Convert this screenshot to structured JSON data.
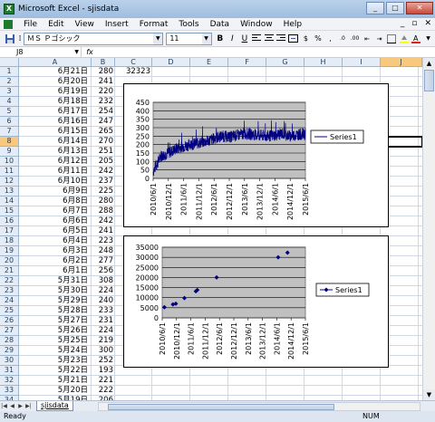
{
  "window": {
    "title": "Microsoft Excel - sjisdata",
    "min": "_",
    "max": "□",
    "close": "✕"
  },
  "menu": [
    "File",
    "Edit",
    "View",
    "Insert",
    "Format",
    "Tools",
    "Data",
    "Window",
    "Help"
  ],
  "menu_doc_controls": [
    "_",
    "▫",
    "✕"
  ],
  "toolbar": {
    "font_name": "ＭＳ Ｐゴシック",
    "font_size": "11",
    "bold": "B",
    "italic": "I",
    "underline": "U"
  },
  "formula_bar": {
    "name_box": "J8",
    "fx": "fx",
    "value": ""
  },
  "columns": [
    "A",
    "B",
    "C",
    "D",
    "E",
    "F",
    "G",
    "H",
    "I",
    "J"
  ],
  "active_column": "J",
  "active_row": 8,
  "rows": [
    {
      "n": "1",
      "a": "6月21日",
      "b": "280",
      "c": "32323"
    },
    {
      "n": "2",
      "a": "6月20日",
      "b": "241",
      "c": ""
    },
    {
      "n": "3",
      "a": "6月19日",
      "b": "220",
      "c": ""
    },
    {
      "n": "4",
      "a": "6月18日",
      "b": "232",
      "c": ""
    },
    {
      "n": "5",
      "a": "6月17日",
      "b": "254",
      "c": ""
    },
    {
      "n": "6",
      "a": "6月16日",
      "b": "247",
      "c": ""
    },
    {
      "n": "7",
      "a": "6月15日",
      "b": "265",
      "c": ""
    },
    {
      "n": "8",
      "a": "6月14日",
      "b": "270",
      "c": ""
    },
    {
      "n": "9",
      "a": "6月13日",
      "b": "251",
      "c": ""
    },
    {
      "n": "10",
      "a": "6月12日",
      "b": "205",
      "c": ""
    },
    {
      "n": "11",
      "a": "6月11日",
      "b": "242",
      "c": ""
    },
    {
      "n": "12",
      "a": "6月10日",
      "b": "237",
      "c": ""
    },
    {
      "n": "13",
      "a": "6月9日",
      "b": "225",
      "c": ""
    },
    {
      "n": "14",
      "a": "6月8日",
      "b": "280",
      "c": ""
    },
    {
      "n": "15",
      "a": "6月7日",
      "b": "288",
      "c": ""
    },
    {
      "n": "16",
      "a": "6月6日",
      "b": "242",
      "c": ""
    },
    {
      "n": "17",
      "a": "6月5日",
      "b": "241",
      "c": ""
    },
    {
      "n": "18",
      "a": "6月4日",
      "b": "223",
      "c": ""
    },
    {
      "n": "19",
      "a": "6月3日",
      "b": "248",
      "c": ""
    },
    {
      "n": "20",
      "a": "6月2日",
      "b": "277",
      "c": ""
    },
    {
      "n": "21",
      "a": "6月1日",
      "b": "256",
      "c": ""
    },
    {
      "n": "22",
      "a": "5月31日",
      "b": "308",
      "c": ""
    },
    {
      "n": "23",
      "a": "5月30日",
      "b": "224",
      "c": ""
    },
    {
      "n": "24",
      "a": "5月29日",
      "b": "240",
      "c": ""
    },
    {
      "n": "25",
      "a": "5月28日",
      "b": "233",
      "c": ""
    },
    {
      "n": "26",
      "a": "5月27日",
      "b": "231",
      "c": ""
    },
    {
      "n": "27",
      "a": "5月26日",
      "b": "224",
      "c": ""
    },
    {
      "n": "28",
      "a": "5月25日",
      "b": "219",
      "c": ""
    },
    {
      "n": "29",
      "a": "5月24日",
      "b": "300",
      "c": ""
    },
    {
      "n": "30",
      "a": "5月23日",
      "b": "252",
      "c": ""
    },
    {
      "n": "31",
      "a": "5月22日",
      "b": "193",
      "c": ""
    },
    {
      "n": "32",
      "a": "5月21日",
      "b": "221",
      "c": ""
    },
    {
      "n": "33",
      "a": "5月20日",
      "b": "222",
      "c": ""
    },
    {
      "n": "34",
      "a": "5月19日",
      "b": "206",
      "c": ""
    }
  ],
  "sheet_tab": "sjisdata",
  "status": {
    "left": "Ready",
    "num": "NUM"
  },
  "chart_data": [
    {
      "type": "line",
      "legend": "Series1",
      "legend_position": "right",
      "ylim": [
        0,
        450
      ],
      "yticks": [
        0,
        50,
        100,
        150,
        200,
        250,
        300,
        350,
        400,
        450
      ],
      "xticks": [
        "2010/6/1",
        "2010/12/1",
        "2011/6/1",
        "2011/12/1",
        "2012/6/1",
        "2012/12/1",
        "2013/6/1",
        "2013/12/1",
        "2014/6/1",
        "2014/12/1",
        "2015/6/1"
      ],
      "grid": true,
      "trend_points": [
        [
          0,
          40
        ],
        [
          0.5,
          130
        ],
        [
          1,
          150
        ],
        [
          1.5,
          175
        ],
        [
          2,
          190
        ],
        [
          2.5,
          200
        ],
        [
          3,
          210
        ],
        [
          3.5,
          220
        ],
        [
          4,
          235
        ],
        [
          4.5,
          250
        ],
        [
          5,
          245
        ],
        [
          5.5,
          255
        ],
        [
          6,
          265
        ],
        [
          6.5,
          260
        ],
        [
          7,
          255
        ],
        [
          7.5,
          250
        ],
        [
          8,
          255
        ],
        [
          8.5,
          265
        ],
        [
          9,
          250
        ],
        [
          9.5,
          260
        ],
        [
          10,
          262
        ]
      ]
    },
    {
      "type": "scatter",
      "legend": "Series1",
      "legend_position": "right",
      "ylim": [
        0,
        35000
      ],
      "yticks": [
        0,
        5000,
        10000,
        15000,
        20000,
        25000,
        30000,
        35000
      ],
      "xticks": [
        "2010/6/1",
        "2010/12/1",
        "2011/6/1",
        "2011/12/1",
        "2012/6/1",
        "2012/12/1",
        "2013/6/1",
        "2013/12/1",
        "2014/6/1",
        "2014/12/1",
        "2015/6/1"
      ],
      "grid": true,
      "points": [
        [
          0.15,
          5300
        ],
        [
          0.75,
          6700
        ],
        [
          0.95,
          7000
        ],
        [
          1.55,
          9800
        ],
        [
          2.35,
          13200
        ],
        [
          2.45,
          13800
        ],
        [
          3.8,
          20000
        ],
        [
          8.1,
          30000
        ],
        [
          8.75,
          32300
        ]
      ]
    }
  ]
}
